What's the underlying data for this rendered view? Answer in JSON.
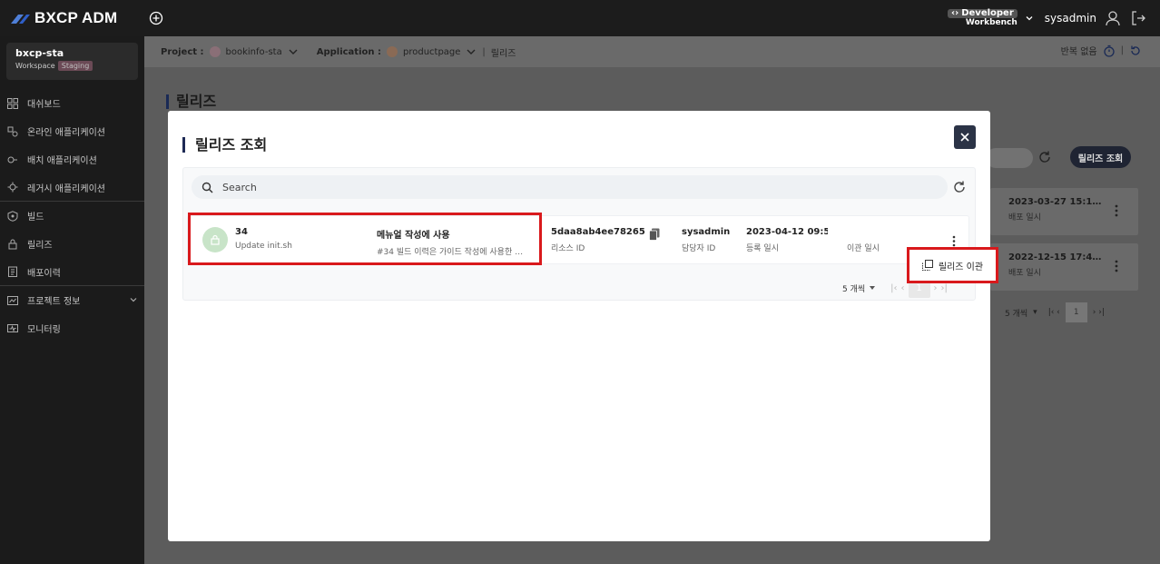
{
  "app": {
    "logo_text": "BXCP ADM",
    "developer_label": "Developer",
    "workbench_label": "Workbench",
    "username": "sysadmin"
  },
  "workspace": {
    "name": "bxcp-sta",
    "label": "Workspace",
    "badge": "Staging"
  },
  "sidebar": {
    "items": [
      {
        "label": "대쉬보드",
        "icon": "dashboard-icon"
      },
      {
        "label": "온라인 애플리케이션",
        "icon": "online-app-icon"
      },
      {
        "label": "배치 애플리케이션",
        "icon": "batch-app-icon"
      },
      {
        "label": "레거시 애플리케이션",
        "icon": "legacy-app-icon"
      },
      {
        "label": "빌드",
        "icon": "build-icon"
      },
      {
        "label": "릴리즈",
        "icon": "release-icon"
      },
      {
        "label": "배포이력",
        "icon": "deploy-history-icon"
      },
      {
        "label": "프로젝트 정보",
        "icon": "project-info-icon"
      },
      {
        "label": "모니터링",
        "icon": "monitoring-icon"
      }
    ]
  },
  "breadcrumb": {
    "project_label": "Project :",
    "project_value": "bookinfo-sta",
    "application_label": "Application :",
    "application_value": "productpage",
    "current": "릴리즈",
    "repeat_label": "반복 없음"
  },
  "page": {
    "title": "릴리즈",
    "release_button": "릴리즈 조회"
  },
  "background_cards": [
    {
      "date": "2023-03-27 15:1…",
      "sub": "배포 일시"
    },
    {
      "date": "2022-12-15 17:4…",
      "sub": "배포 일시"
    }
  ],
  "background_pagination": {
    "page_size": "5 개씩",
    "page": "1"
  },
  "modal": {
    "title": "릴리즈 조회",
    "search_placeholder": "Search",
    "row": {
      "number": "34",
      "commit_message": "Update init.sh",
      "name": "메뉴얼 작성에 사용",
      "description": "#34 빌드 이력은 가이드 작성에 사용한 …",
      "resource_id": "5daa8ab4ee78265a…",
      "resource_id_label": "리소스 ID",
      "owner": "sysadmin",
      "owner_label": "담당자 ID",
      "registered_at": "2023-04-12 09:5…",
      "registered_label": "등록 일시",
      "transfer_label": "이관 일시"
    },
    "pagination": {
      "page_size": "5 개씩",
      "page": "1"
    },
    "popover": {
      "transfer_action": "릴리즈 이관"
    }
  },
  "colors": {
    "accent": "#1e2a55",
    "highlight": "#d9191c",
    "avatar_bg": "#c8e4c8"
  }
}
